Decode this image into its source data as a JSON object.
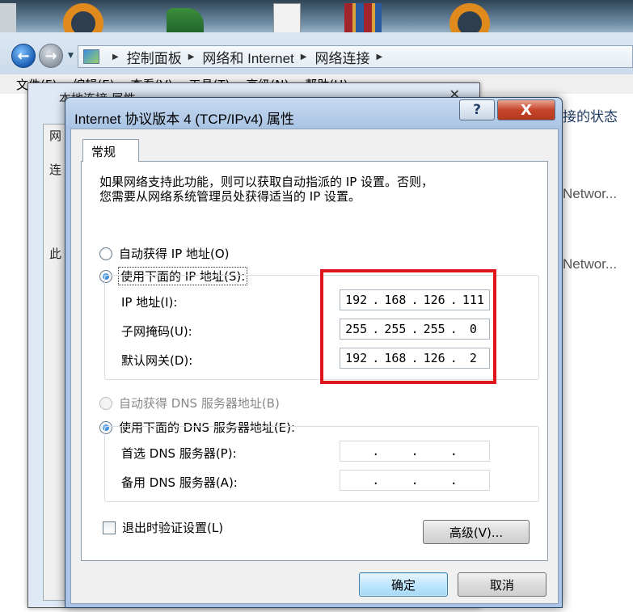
{
  "breadcrumb": [
    "控制面板",
    "网络和 Internet",
    "网络连接"
  ],
  "menu": [
    "文件(F)",
    "编辑(E)",
    "查看(V)",
    "工具(T)",
    "高级(N)",
    "帮助(H)"
  ],
  "right_panel": {
    "title_fragment": "接的状态",
    "items": [
      "Networ...",
      "Networ..."
    ]
  },
  "back_window": {
    "title_fragment": "本地连接 属性",
    "fragments": [
      "网",
      "连",
      "此"
    ]
  },
  "dialog": {
    "title": "Internet 协议版本 4 (TCP/IPv4) 属性",
    "help_glyph": "?",
    "close_glyph": "X",
    "tab_label": "常规",
    "description_line1": "如果网络支持此功能，则可以获取自动指派的 IP 设置。否则，",
    "description_line2": "您需要从网络系统管理员处获得适当的 IP 设置。",
    "ip": {
      "auto_label": "自动获得 IP 地址(O)",
      "manual_label": "使用下面的 IP 地址(S):",
      "auto_selected": false,
      "fields": [
        {
          "label": "IP 地址(I):",
          "octets": [
            "192",
            "168",
            "126",
            "111"
          ]
        },
        {
          "label": "子网掩码(U):",
          "octets": [
            "255",
            "255",
            "255",
            "0"
          ]
        },
        {
          "label": "默认网关(D):",
          "octets": [
            "192",
            "168",
            "126",
            "2"
          ]
        }
      ]
    },
    "dns": {
      "auto_label": "自动获得 DNS 服务器地址(B)",
      "manual_label": "使用下面的 DNS 服务器地址(E):",
      "auto_enabled": false,
      "fields": [
        {
          "label": "首选 DNS 服务器(P):",
          "octets": [
            "",
            "",
            "",
            ""
          ]
        },
        {
          "label": "备用 DNS 服务器(A):",
          "octets": [
            "",
            "",
            "",
            ""
          ]
        }
      ]
    },
    "validate_label": "退出时验证设置(L)",
    "validate_checked": false,
    "advanced_button": "高级(V)...",
    "ok_button": "确定",
    "cancel_button": "取消"
  },
  "colors": {
    "highlight_box": "#e0161d",
    "title_close": "#c5442a"
  }
}
